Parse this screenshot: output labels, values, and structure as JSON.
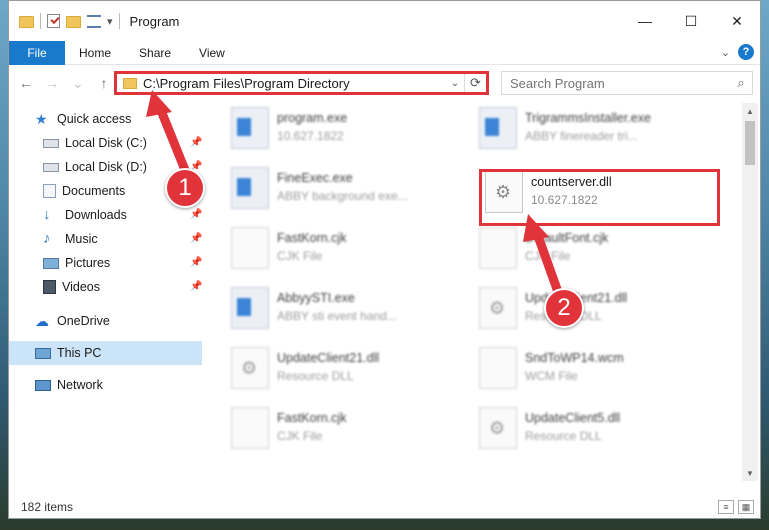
{
  "window": {
    "title": "Program"
  },
  "ribbon": {
    "tabs": [
      "File",
      "Home",
      "Share",
      "View"
    ],
    "help": "?"
  },
  "nav": {
    "back": "←",
    "forward": "→",
    "up": "↑",
    "refresh": "⟳"
  },
  "address": {
    "path": "C:\\Program Files\\Program Directory"
  },
  "search": {
    "placeholder": "Search Program"
  },
  "sidebar": {
    "items": [
      {
        "label": "Quick access",
        "icon": "star-icon",
        "pinned": false
      },
      {
        "label": "Local Disk (C:)",
        "icon": "drive-icon",
        "pinned": true
      },
      {
        "label": "Local Disk (D:)",
        "icon": "drive-icon",
        "pinned": true
      },
      {
        "label": "Documents",
        "icon": "documents-icon",
        "pinned": true
      },
      {
        "label": "Downloads",
        "icon": "download-icon",
        "pinned": true
      },
      {
        "label": "Music",
        "icon": "music-icon",
        "pinned": true
      },
      {
        "label": "Pictures",
        "icon": "pictures-icon",
        "pinned": true
      },
      {
        "label": "Videos",
        "icon": "videos-icon",
        "pinned": true
      },
      {
        "label": "OneDrive",
        "icon": "cloud-icon",
        "pinned": false
      },
      {
        "label": "This PC",
        "icon": "computer-icon",
        "pinned": false
      },
      {
        "label": "Network",
        "icon": "network-icon",
        "pinned": false
      }
    ]
  },
  "files": [
    {
      "name": "program.exe",
      "sub": "10.627.1822",
      "type": "exe"
    },
    {
      "name": "TrigrammsInstaller.exe",
      "sub": "ABBY finereader tri...",
      "type": "exe"
    },
    {
      "name": "FineExec.exe",
      "sub": "ABBY background exe...",
      "type": "exe"
    },
    {
      "name": "countserver.dll",
      "sub": "10.627.1822",
      "type": "dll"
    },
    {
      "name": "FastKorn.cjk",
      "sub": "CJK File",
      "type": "doc"
    },
    {
      "name": "DefaultFont.cjk",
      "sub": "CJK File",
      "type": "doc"
    },
    {
      "name": "AbbyySTI.exe",
      "sub": "ABBY sti event hand...",
      "type": "exe"
    },
    {
      "name": "UpdateClient21.dll",
      "sub": "Resource DLL",
      "type": "dll"
    },
    {
      "name": "UpdateClient21.dll",
      "sub": "Resource DLL",
      "type": "dll"
    },
    {
      "name": "SndToWP14.wcm",
      "sub": "WCM File",
      "type": "doc"
    },
    {
      "name": "FastKorn.cjk",
      "sub": "CJK File",
      "type": "doc"
    },
    {
      "name": "UpdateClient5.dll",
      "sub": "Resource DLL",
      "type": "dll"
    }
  ],
  "status": {
    "count": "182 items"
  },
  "annotations": {
    "badge1": "1",
    "badge2": "2",
    "accent": "#e0333a"
  },
  "colors": {
    "file_tab": "#1979ca",
    "selected": "#cce4f7"
  }
}
